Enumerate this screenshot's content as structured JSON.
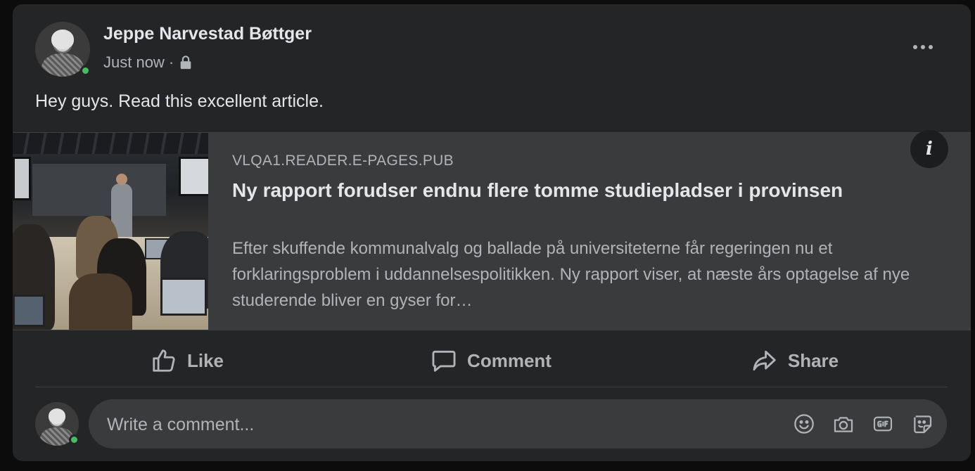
{
  "post": {
    "author_name": "Jeppe Narvestad Bøttger",
    "timestamp": "Just now",
    "separator": "·",
    "privacy_icon": "lock-icon",
    "text": "Hey guys. Read this excellent article.",
    "author_online": true
  },
  "link_preview": {
    "domain": "VLQA1.READER.E-PAGES.PUB",
    "headline": "Ny rapport forudser endnu flere tomme studiepladser i provinsen",
    "description": "Efter skuffende kommunalvalg og ballade på universiteterne får regeringen nu et forklaringsproblem i uddannelsespolitikken. Ny rapport viser, at næste års optagelse af nye studerende bliver en gyser for…",
    "info_label": "i"
  },
  "actions": {
    "like_label": "Like",
    "comment_label": "Comment",
    "share_label": "Share"
  },
  "comment_composer": {
    "placeholder": "Write a comment...",
    "icons": [
      "emoji-icon",
      "camera-icon",
      "gif-icon",
      "sticker-icon"
    ]
  },
  "colors": {
    "card_bg": "#242526",
    "preview_bg": "#3a3b3c",
    "primary_text": "#e4e6eb",
    "secondary_text": "#b0b3b8",
    "online": "#45bd62"
  }
}
